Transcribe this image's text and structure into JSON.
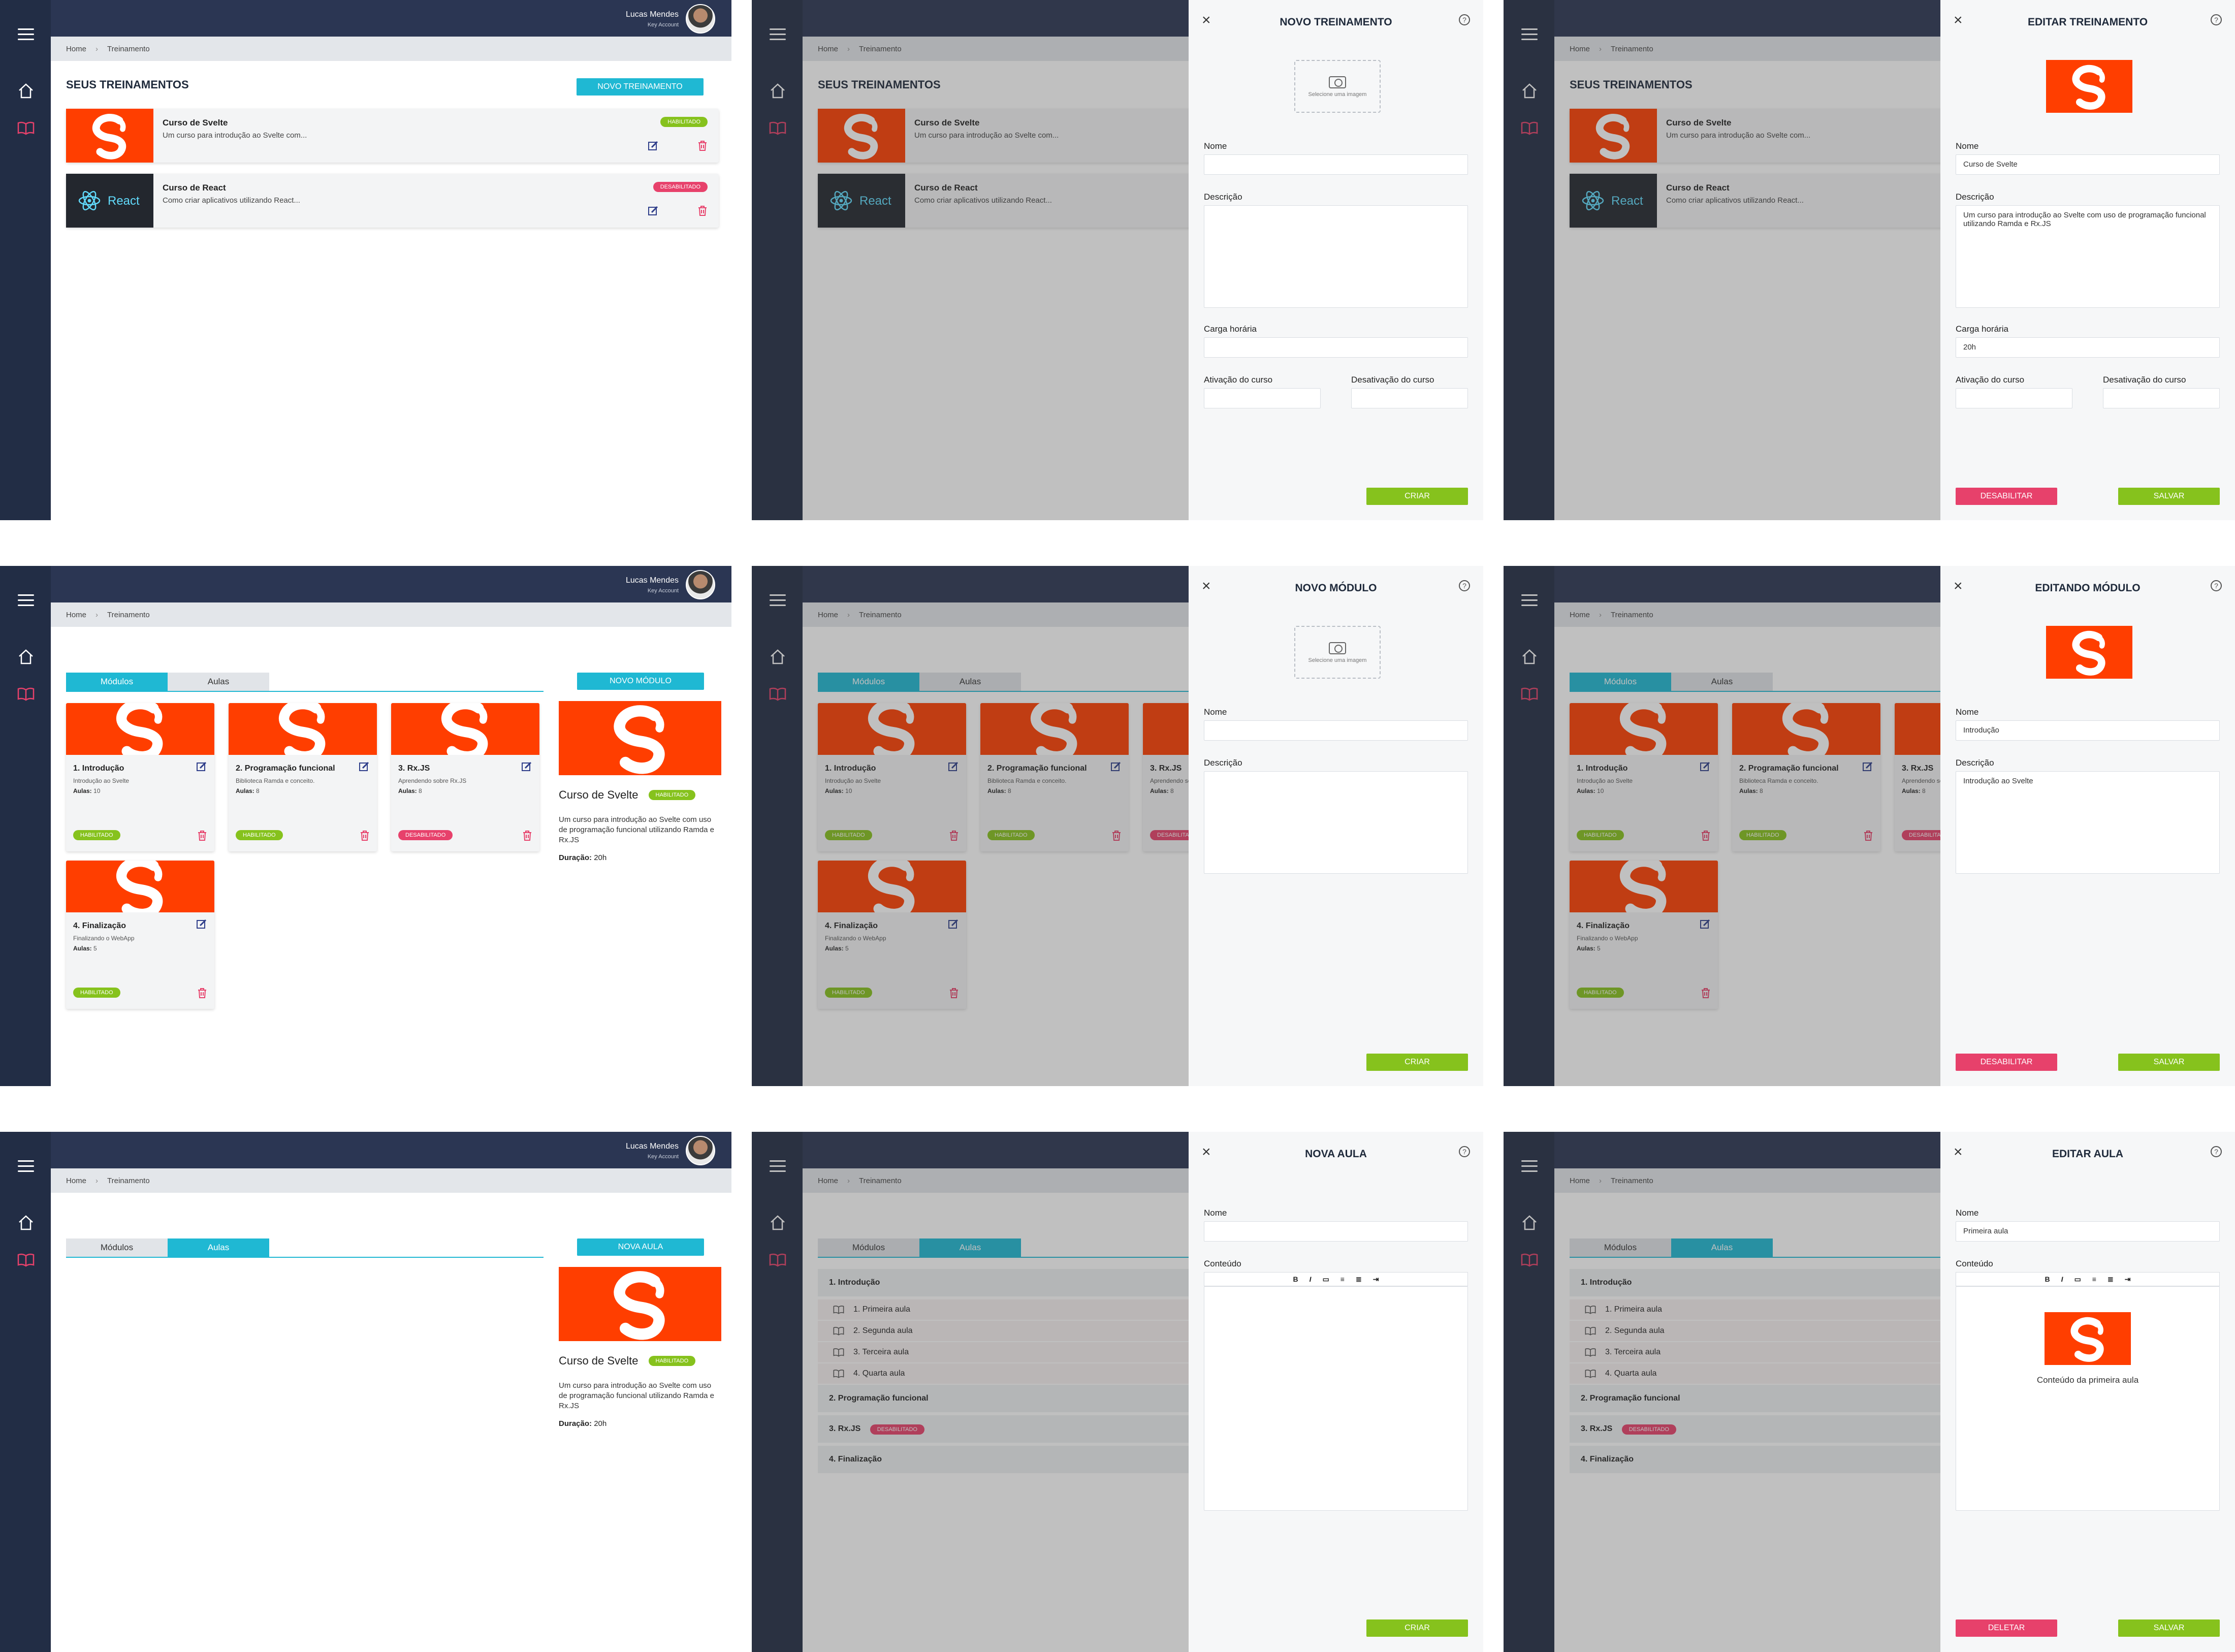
{
  "user": {
    "name": "Lucas Mendes",
    "role": "Key Account"
  },
  "breadcrumb": {
    "home": "Home",
    "current": "Treinamento"
  },
  "trainings": {
    "title": "SEUS TREINAMENTOS",
    "new_button": "NOVO TREINAMENTO",
    "items": [
      {
        "name": "Curso de Svelte",
        "desc": "Um curso para introdução ao Svelte com...",
        "status": "HABILITADO",
        "logo": "svelte"
      },
      {
        "name": "Curso de React",
        "desc": "Como criar aplicativos utilizando React...",
        "status": "DESABILITADO",
        "logo": "React"
      }
    ]
  },
  "panel_new_training": {
    "title": "NOVO TREINAMENTO",
    "image_hint": "Selecione uma imagem",
    "name_label": "Nome",
    "desc_label": "Descrição",
    "hours_label": "Carga horária",
    "activation_label": "Ativação do curso",
    "deactivation_label": "Desativação do curso",
    "create": "CRIAR"
  },
  "panel_edit_training": {
    "title": "EDITAR TREINAMENTO",
    "name_label": "Nome",
    "name_value": "Curso de Svelte",
    "desc_label": "Descrição",
    "desc_value": "Um curso para introdução ao Svelte com uso de programação funcional utilizando Ramda e Rx.JS",
    "hours_label": "Carga horária",
    "hours_value": "20h",
    "activation_label": "Ativação do curso",
    "deactivation_label": "Desativação do curso",
    "disable": "DESABILITAR",
    "save": "SALVAR"
  },
  "tabs": {
    "modules": "Módulos",
    "lessons": "Aulas"
  },
  "modules": {
    "new_button": "NOVO MÓDULO",
    "lessons_label": "Aulas:",
    "items": [
      {
        "name": "1. Introdução",
        "desc": "Introdução ao Svelte",
        "lessons": "10",
        "status": "HABILITADO"
      },
      {
        "name": "2. Programação funcional",
        "desc": "Biblioteca Ramda e conceito.",
        "lessons": "8",
        "status": "HABILITADO"
      },
      {
        "name": "3. Rx.JS",
        "desc": "Aprendendo sobre Rx.JS",
        "lessons": "8",
        "status": "DESABILITADO"
      },
      {
        "name": "4. Finalização",
        "desc": "Finalizando o WebApp",
        "lessons": "5",
        "status": "HABILITADO"
      }
    ]
  },
  "course_info": {
    "title": "Curso de Svelte",
    "status": "HABILITADO",
    "desc": "Um curso para introdução ao Svelte com uso de programação funcional utilizando Ramda e Rx.JS",
    "duration_label": "Duração:",
    "duration_value": "20h"
  },
  "panel_new_module": {
    "title": "NOVO MÓDULO",
    "image_hint": "Selecione uma imagem",
    "name_label": "Nome",
    "desc_label": "Descrição",
    "create": "CRIAR"
  },
  "panel_edit_module": {
    "title": "EDITANDO MÓDULO",
    "name_label": "Nome",
    "name_value": "Introdução",
    "desc_label": "Descrição",
    "desc_value": "Introdução ao Svelte",
    "disable": "DESABILITAR",
    "save": "SALVAR"
  },
  "lessons": {
    "new_button": "NOVA AULA",
    "groups": [
      {
        "name": "1. Introdução",
        "items": [
          "1. Primeira aula",
          "2. Segunda aula",
          "3. Terceira aula",
          "4. Quarta aula"
        ]
      },
      {
        "name": "2. Programação funcional",
        "items": []
      },
      {
        "name": "3. Rx.JS",
        "badge": "DESABILITADO",
        "items": []
      },
      {
        "name": "4. Finalização",
        "items": []
      }
    ]
  },
  "panel_new_lesson": {
    "title": "NOVA AULA",
    "name_label": "Nome",
    "content_label": "Conteúdo",
    "create": "CRIAR"
  },
  "panel_edit_lesson": {
    "title": "EDITAR AULA",
    "name_label": "Nome",
    "name_value": "Primeira aula",
    "content_label": "Conteúdo",
    "content_text": "Conteúdo da primeira aula",
    "delete": "DELETAR",
    "save": "SALVAR"
  },
  "colors": {
    "sidebar": "#222d45",
    "topbar": "#2b3653",
    "accent": "#1fb8d3",
    "green": "#86c21d",
    "red": "#e7416b",
    "svelte": "#ff3e00"
  }
}
